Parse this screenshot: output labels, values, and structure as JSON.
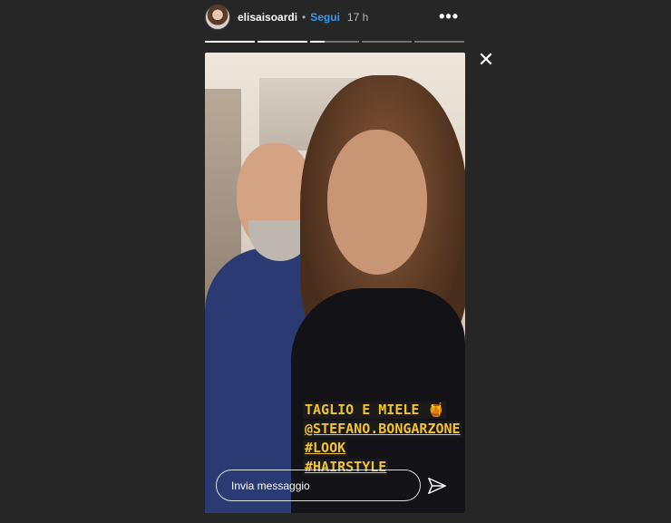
{
  "header": {
    "username": "elisaisoardi",
    "separator": "•",
    "follow_label": "Segui",
    "time": "17 h",
    "more_glyph": "•••"
  },
  "progress": {
    "segments": 5,
    "current_index": 2,
    "current_fraction": 0.3
  },
  "close_glyph": "✕",
  "story": {
    "caption_lines": [
      "TAGLIO E MIELE 🍯",
      "@STEFANO.BONGARZONE",
      "#LOOK",
      "#HAIRSTYLE"
    ]
  },
  "reply": {
    "placeholder": "Invia messaggio"
  },
  "icons": {
    "send": "send-icon",
    "close": "close-icon",
    "more": "more-options-icon"
  },
  "colors": {
    "background": "#262626",
    "follow": "#3897f0",
    "caption_text": "#f2c32a"
  }
}
